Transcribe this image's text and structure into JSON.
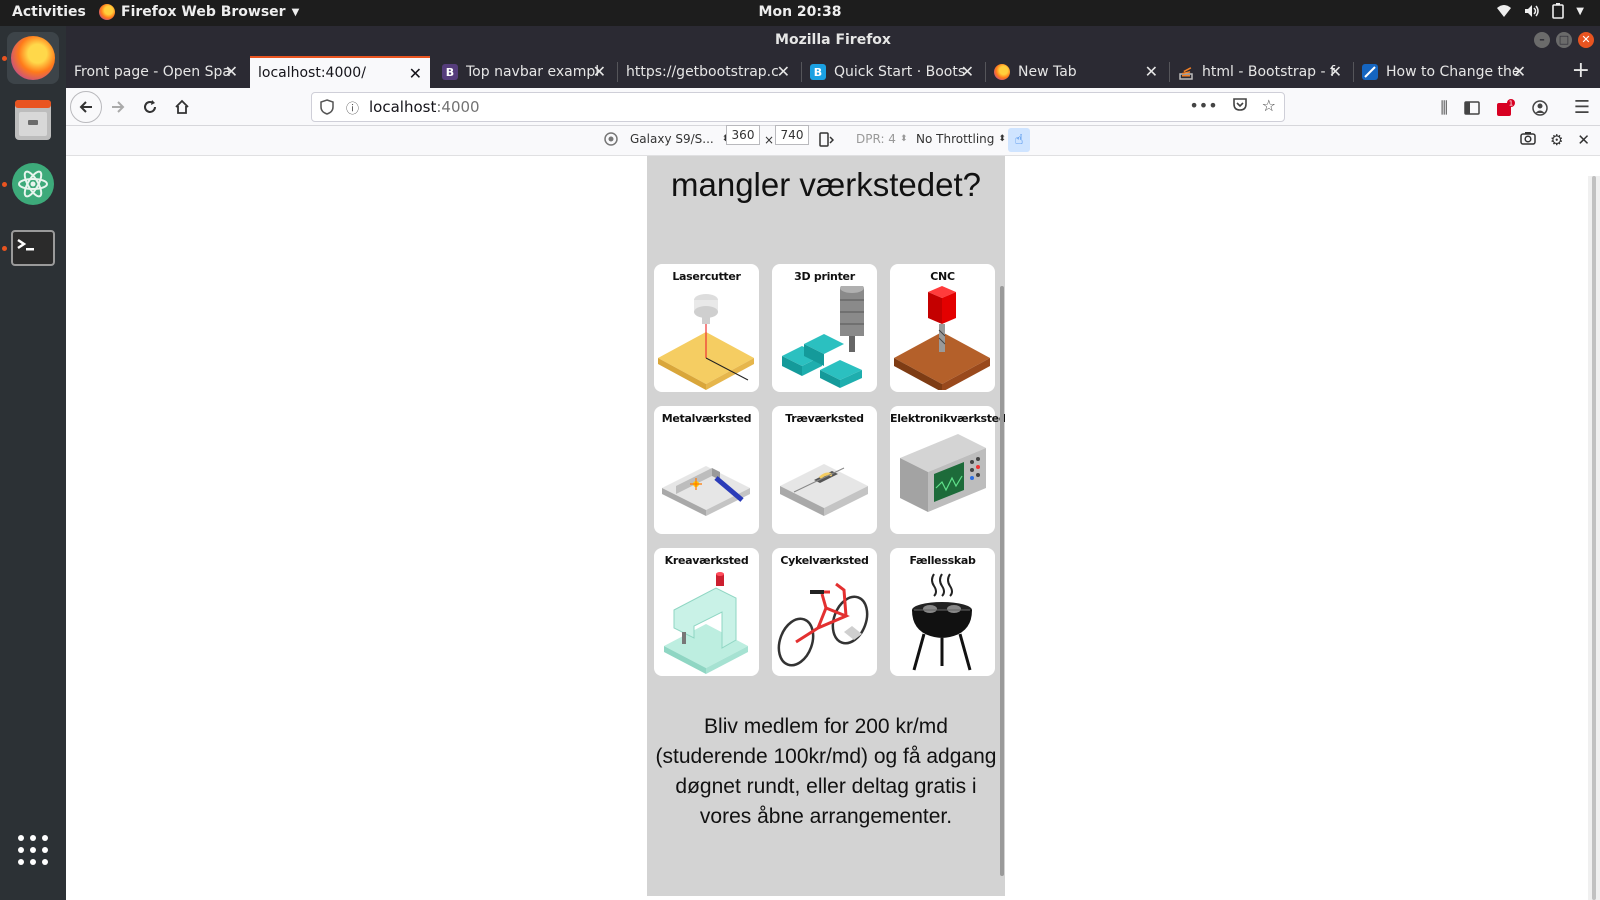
{
  "system_bar": {
    "activities": "Activities",
    "app_menu": "Firefox Web Browser",
    "clock": "Mon 20:38"
  },
  "window": {
    "title": "Mozilla Firefox"
  },
  "tabs": [
    {
      "title": "Front page - Open Spa",
      "favicon_color": "#e95420",
      "favicon_text": ""
    },
    {
      "title": "localhost:4000/",
      "favicon_color": "",
      "favicon_text": "",
      "active": true
    },
    {
      "title": "Top navbar exampl",
      "favicon_color": "#563d7c",
      "favicon_text": "B"
    },
    {
      "title": "https://getbootstrap.c",
      "favicon_color": "",
      "favicon_text": ""
    },
    {
      "title": "Quick Start · Boots",
      "favicon_color": "#1ba1e2",
      "favicon_text": "B"
    },
    {
      "title": "New Tab",
      "favicon_color": "#ff7a1a",
      "favicon_text": ""
    },
    {
      "title": "html - Bootstrap - f",
      "favicon_color": "#f48024",
      "favicon_text": ""
    },
    {
      "title": "How to Change the",
      "favicon_color": "#1565c0",
      "favicon_text": ""
    }
  ],
  "url": {
    "host": "localhost",
    "port": ":4000"
  },
  "rdm": {
    "device": "Galaxy S9/S...",
    "width": "360",
    "height": "740",
    "dpr": "DPR: 4",
    "throttling": "No Throttling"
  },
  "page": {
    "heading": "mangler værkstedet?",
    "cards": [
      {
        "label": "Lasercutter",
        "icon": "laser-cutter-icon"
      },
      {
        "label": "3D printer",
        "icon": "3d-printer-icon"
      },
      {
        "label": "CNC",
        "icon": "cnc-icon"
      },
      {
        "label": "Metalværksted",
        "icon": "welding-icon"
      },
      {
        "label": "Træværksted",
        "icon": "table-saw-icon"
      },
      {
        "label": "Elektronikværksted",
        "icon": "oscilloscope-icon"
      },
      {
        "label": "Kreaværksted",
        "icon": "sewing-machine-icon"
      },
      {
        "label": "Cykelværksted",
        "icon": "bicycle-icon"
      },
      {
        "label": "Fællesskab",
        "icon": "grill-icon"
      }
    ],
    "membership_text": "Bliv medlem for 200 kr/md (studerende 100kr/md) og få adgang døgnet rundt, eller deltag gratis i vores åbne arrangementer."
  }
}
